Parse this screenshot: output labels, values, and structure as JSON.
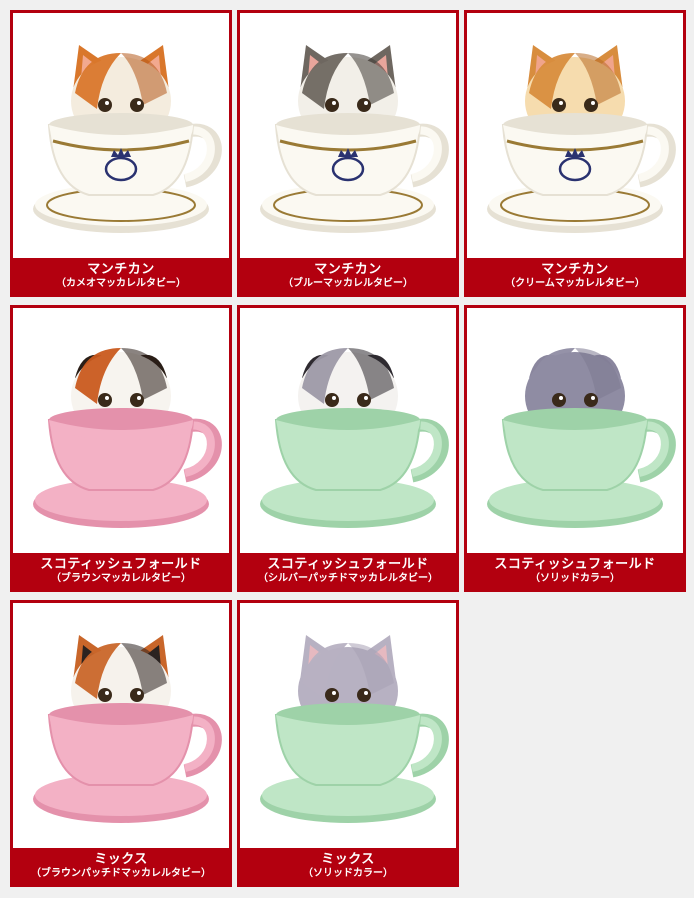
{
  "colors": {
    "frame_red": "#b3000f",
    "cup_white": "#fbf9f2",
    "cup_pink": "#f3b1c5",
    "cup_green": "#bfe6c6",
    "gold_trim": "#9a7a35",
    "emblem_navy": "#2a3270"
  },
  "items": [
    {
      "name": "マンチカン",
      "variant": "（カメオマッカレルタビー）",
      "cup": "white",
      "cat_breed": "munchkin",
      "fur": "orange-white",
      "icon": "cat-in-white-cup-icon"
    },
    {
      "name": "マンチカン",
      "variant": "（ブルーマッカレルタビー）",
      "cup": "white",
      "cat_breed": "munchkin",
      "fur": "gray-tabby-white",
      "icon": "cat-in-white-cup-icon"
    },
    {
      "name": "マンチカン",
      "variant": "（クリームマッカレルタビー）",
      "cup": "white",
      "cat_breed": "munchkin",
      "fur": "cream-orange",
      "icon": "cat-in-white-cup-icon"
    },
    {
      "name": "スコティッシュフォールド",
      "variant": "（ブラウンマッカレルタビー）",
      "cup": "pink",
      "cat_breed": "scottish-fold",
      "fur": "calico-brown",
      "icon": "cat-in-pink-cup-icon"
    },
    {
      "name": "スコティッシュフォールド",
      "variant": "（シルバーパッチドマッカレルタビー）",
      "cup": "green",
      "cat_breed": "scottish-fold",
      "fur": "silver-tabby",
      "icon": "cat-in-green-cup-icon"
    },
    {
      "name": "スコティッシュフォールド",
      "variant": "（ソリッドカラー）",
      "cup": "green",
      "cat_breed": "scottish-fold",
      "fur": "solid-gray",
      "icon": "cat-in-green-cup-icon"
    },
    {
      "name": "ミックス",
      "variant": "（ブラウンパッチドマッカレルタビー）",
      "cup": "pink",
      "cat_breed": "mix",
      "fur": "calico",
      "icon": "cat-in-pink-cup-icon"
    },
    {
      "name": "ミックス",
      "variant": "（ソリッドカラー）",
      "cup": "green",
      "cat_breed": "mix",
      "fur": "solid-lavender",
      "icon": "cat-in-green-cup-icon"
    }
  ]
}
